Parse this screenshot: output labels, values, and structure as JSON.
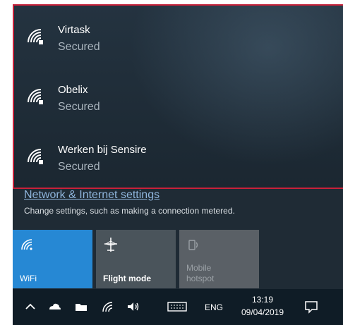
{
  "networks": [
    {
      "name": "Virtask",
      "status": "Secured",
      "icon": "wifi-secured-icon"
    },
    {
      "name": "Obelix",
      "status": "Secured",
      "icon": "wifi-secured-icon"
    },
    {
      "name": "Werken bij Sensire",
      "status": "Secured",
      "icon": "wifi-secured-icon"
    }
  ],
  "settings": {
    "link_label": "Network & Internet settings",
    "description": "Change settings, such as making a connection metered."
  },
  "quick_actions": [
    {
      "label": "WiFi",
      "state": "on",
      "icon": "wifi-icon",
      "color": "#2688d4"
    },
    {
      "label": "Flight mode",
      "state": "off",
      "icon": "airplane-icon",
      "color": "#4a545b"
    },
    {
      "label": "Mobile\nhotspot",
      "state": "disabled",
      "icon": "hotspot-icon",
      "color": "#5a6066"
    }
  ],
  "taskbar": {
    "language": "ENG",
    "time": "13:19",
    "date": "09/04/2019",
    "icons": [
      "chevron-up-icon",
      "cloud-icon",
      "folder-icon",
      "wifi-icon",
      "volume-icon",
      "keyboard-icon",
      "notification-icon"
    ]
  },
  "colors": {
    "highlight_border": "#c8213a",
    "accent": "#2688d4",
    "link": "#8fb5dc"
  }
}
